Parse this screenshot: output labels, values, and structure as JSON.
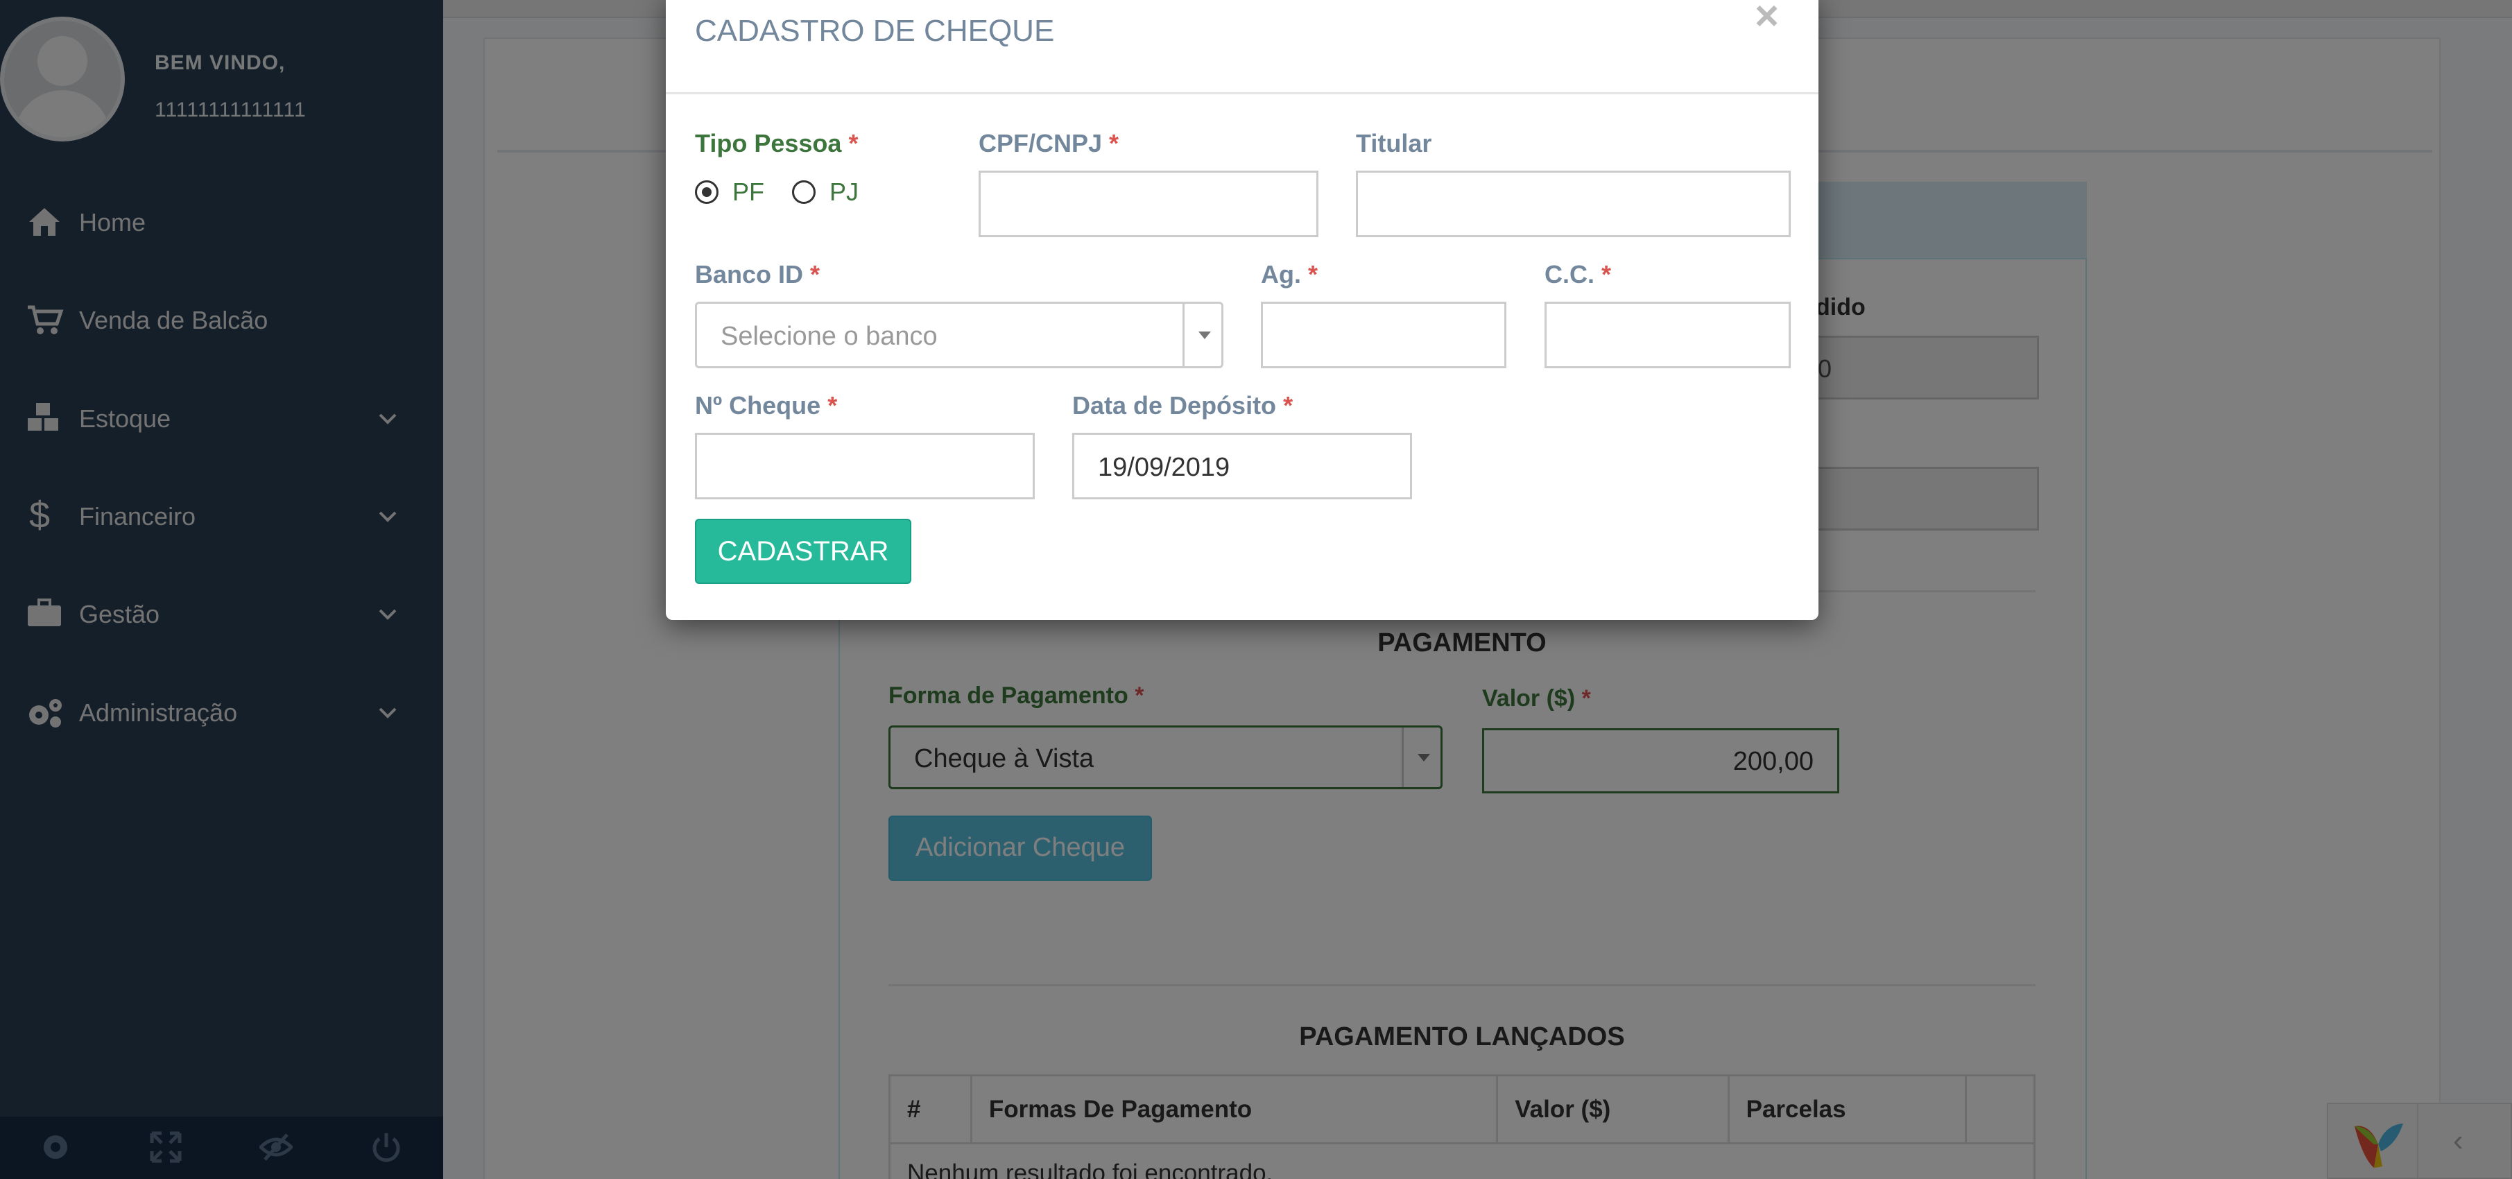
{
  "sidebar": {
    "welcome": "BEM VINDO,",
    "username": "11111111111111",
    "items": [
      {
        "label": "Home",
        "icon": "home-icon",
        "has_submenu": false
      },
      {
        "label": "Venda de Balcão",
        "icon": "cart-icon",
        "has_submenu": false
      },
      {
        "label": "Estoque",
        "icon": "cubes-icon",
        "has_submenu": true
      },
      {
        "label": "Financeiro",
        "icon": "dollar-icon",
        "has_submenu": true
      },
      {
        "label": "Gestão",
        "icon": "briefcase-icon",
        "has_submenu": true
      },
      {
        "label": "Administração",
        "icon": "gears-icon",
        "has_submenu": true
      }
    ],
    "footer_icons": [
      "settings-icon",
      "fullscreen-icon",
      "hide-icon",
      "logout-icon"
    ]
  },
  "background": {
    "pedido_label": "dido",
    "pedido_value": "0",
    "pagamento_title": "PAGAMENTO",
    "forma_pagamento_label": "Forma de Pagamento",
    "forma_pagamento_value": "Cheque à Vista",
    "valor_label": "Valor ($)",
    "valor_value": "200,00",
    "adicionar_cheque": "Adicionar Cheque",
    "lancados_title": "PAGAMENTO LANÇADOS",
    "table_headers": [
      "#",
      "Formas De Pagamento",
      "Valor ($)",
      "Parcelas",
      ""
    ],
    "empty_text": "Nenhum resultado foi encontrado."
  },
  "modal": {
    "title": "CADASTRO DE CHEQUE",
    "close": "×",
    "tipo_pessoa_label": "Tipo Pessoa",
    "pf": "PF",
    "pj": "PJ",
    "selected_tipo": "PF",
    "cpf_label": "CPF/CNPJ",
    "cpf_value": "",
    "titular_label": "Titular",
    "titular_value": "",
    "banco_label": "Banco ID",
    "banco_placeholder": "Selecione o banco",
    "ag_label": "Ag.",
    "ag_value": "",
    "cc_label": "C.C.",
    "cc_value": "",
    "cheque_label": "Nº Cheque",
    "cheque_value": "",
    "data_label": "Data de Depósito",
    "data_value": "19/09/2019",
    "submit": "CADASTRAR",
    "required_mark": "*"
  },
  "colors": {
    "sidebar_bg": "#2a3f54",
    "primary_green": "#26b99a",
    "valid_green": "#3c763d",
    "info_blue": "#5bc0de",
    "required_red": "#d9534f"
  }
}
